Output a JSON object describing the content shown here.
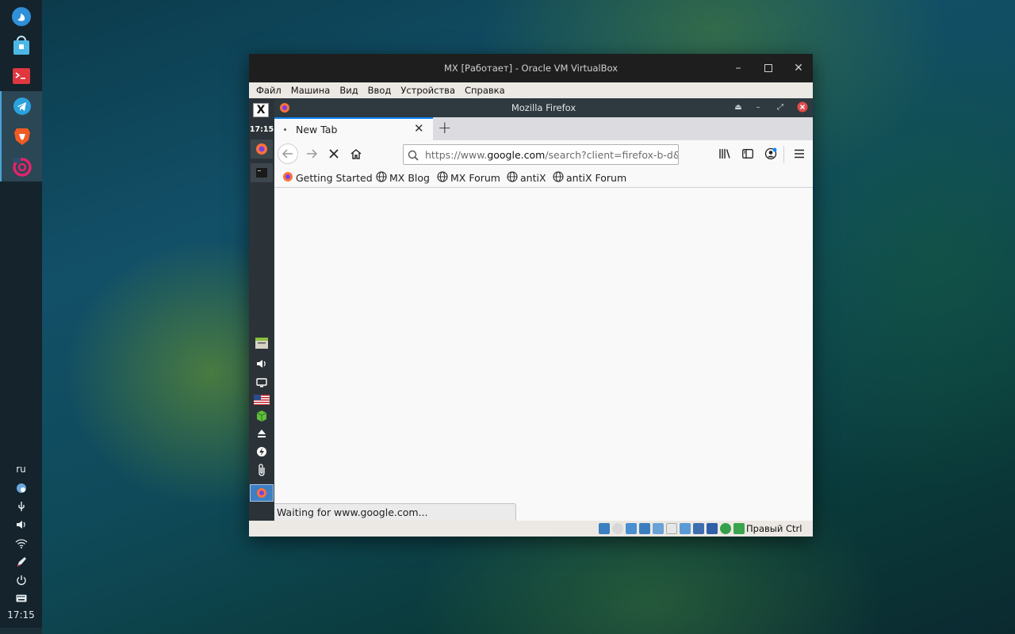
{
  "desktop": {
    "dock": {
      "apps": [
        {
          "name": "deepin-launcher",
          "icon": "launcher-icon"
        },
        {
          "name": "file-manager",
          "icon": "store-icon"
        },
        {
          "name": "terminal",
          "icon": "terminal-icon"
        },
        {
          "name": "telegram",
          "icon": "telegram-icon"
        },
        {
          "name": "brave",
          "icon": "brave-icon"
        },
        {
          "name": "debian",
          "icon": "debian-icon"
        }
      ],
      "tray": {
        "keyboard_layout": "ru",
        "clock": "17:15"
      }
    }
  },
  "vbox": {
    "title": "MX [Работает] - Oracle VM VirtualBox",
    "menu": [
      "Файл",
      "Машина",
      "Вид",
      "Ввод",
      "Устройства",
      "Справка"
    ],
    "host_key": "Правый Ctrl"
  },
  "guest": {
    "panel": {
      "clock": "17:15"
    },
    "firefox": {
      "window_title": "Mozilla Firefox",
      "tab": {
        "label": "New Tab"
      },
      "url": {
        "prefix": "https://www.",
        "domain": "google.com",
        "suffix": "/search?client=firefox-b-d&q="
      },
      "bookmarks": [
        {
          "label": "Getting Started",
          "icon": "firefox-icon"
        },
        {
          "label": "MX Blog",
          "icon": "globe-icon"
        },
        {
          "label": "MX Forum",
          "icon": "globe-icon"
        },
        {
          "label": "antiX",
          "icon": "globe-icon"
        },
        {
          "label": "antiX Forum",
          "icon": "globe-icon"
        }
      ],
      "status": "Waiting for www.google.com..."
    }
  },
  "colors": {
    "accent": "#0a84ff",
    "host_dock": "#14232c",
    "vbox_titlebar": "#1e1e1e"
  }
}
